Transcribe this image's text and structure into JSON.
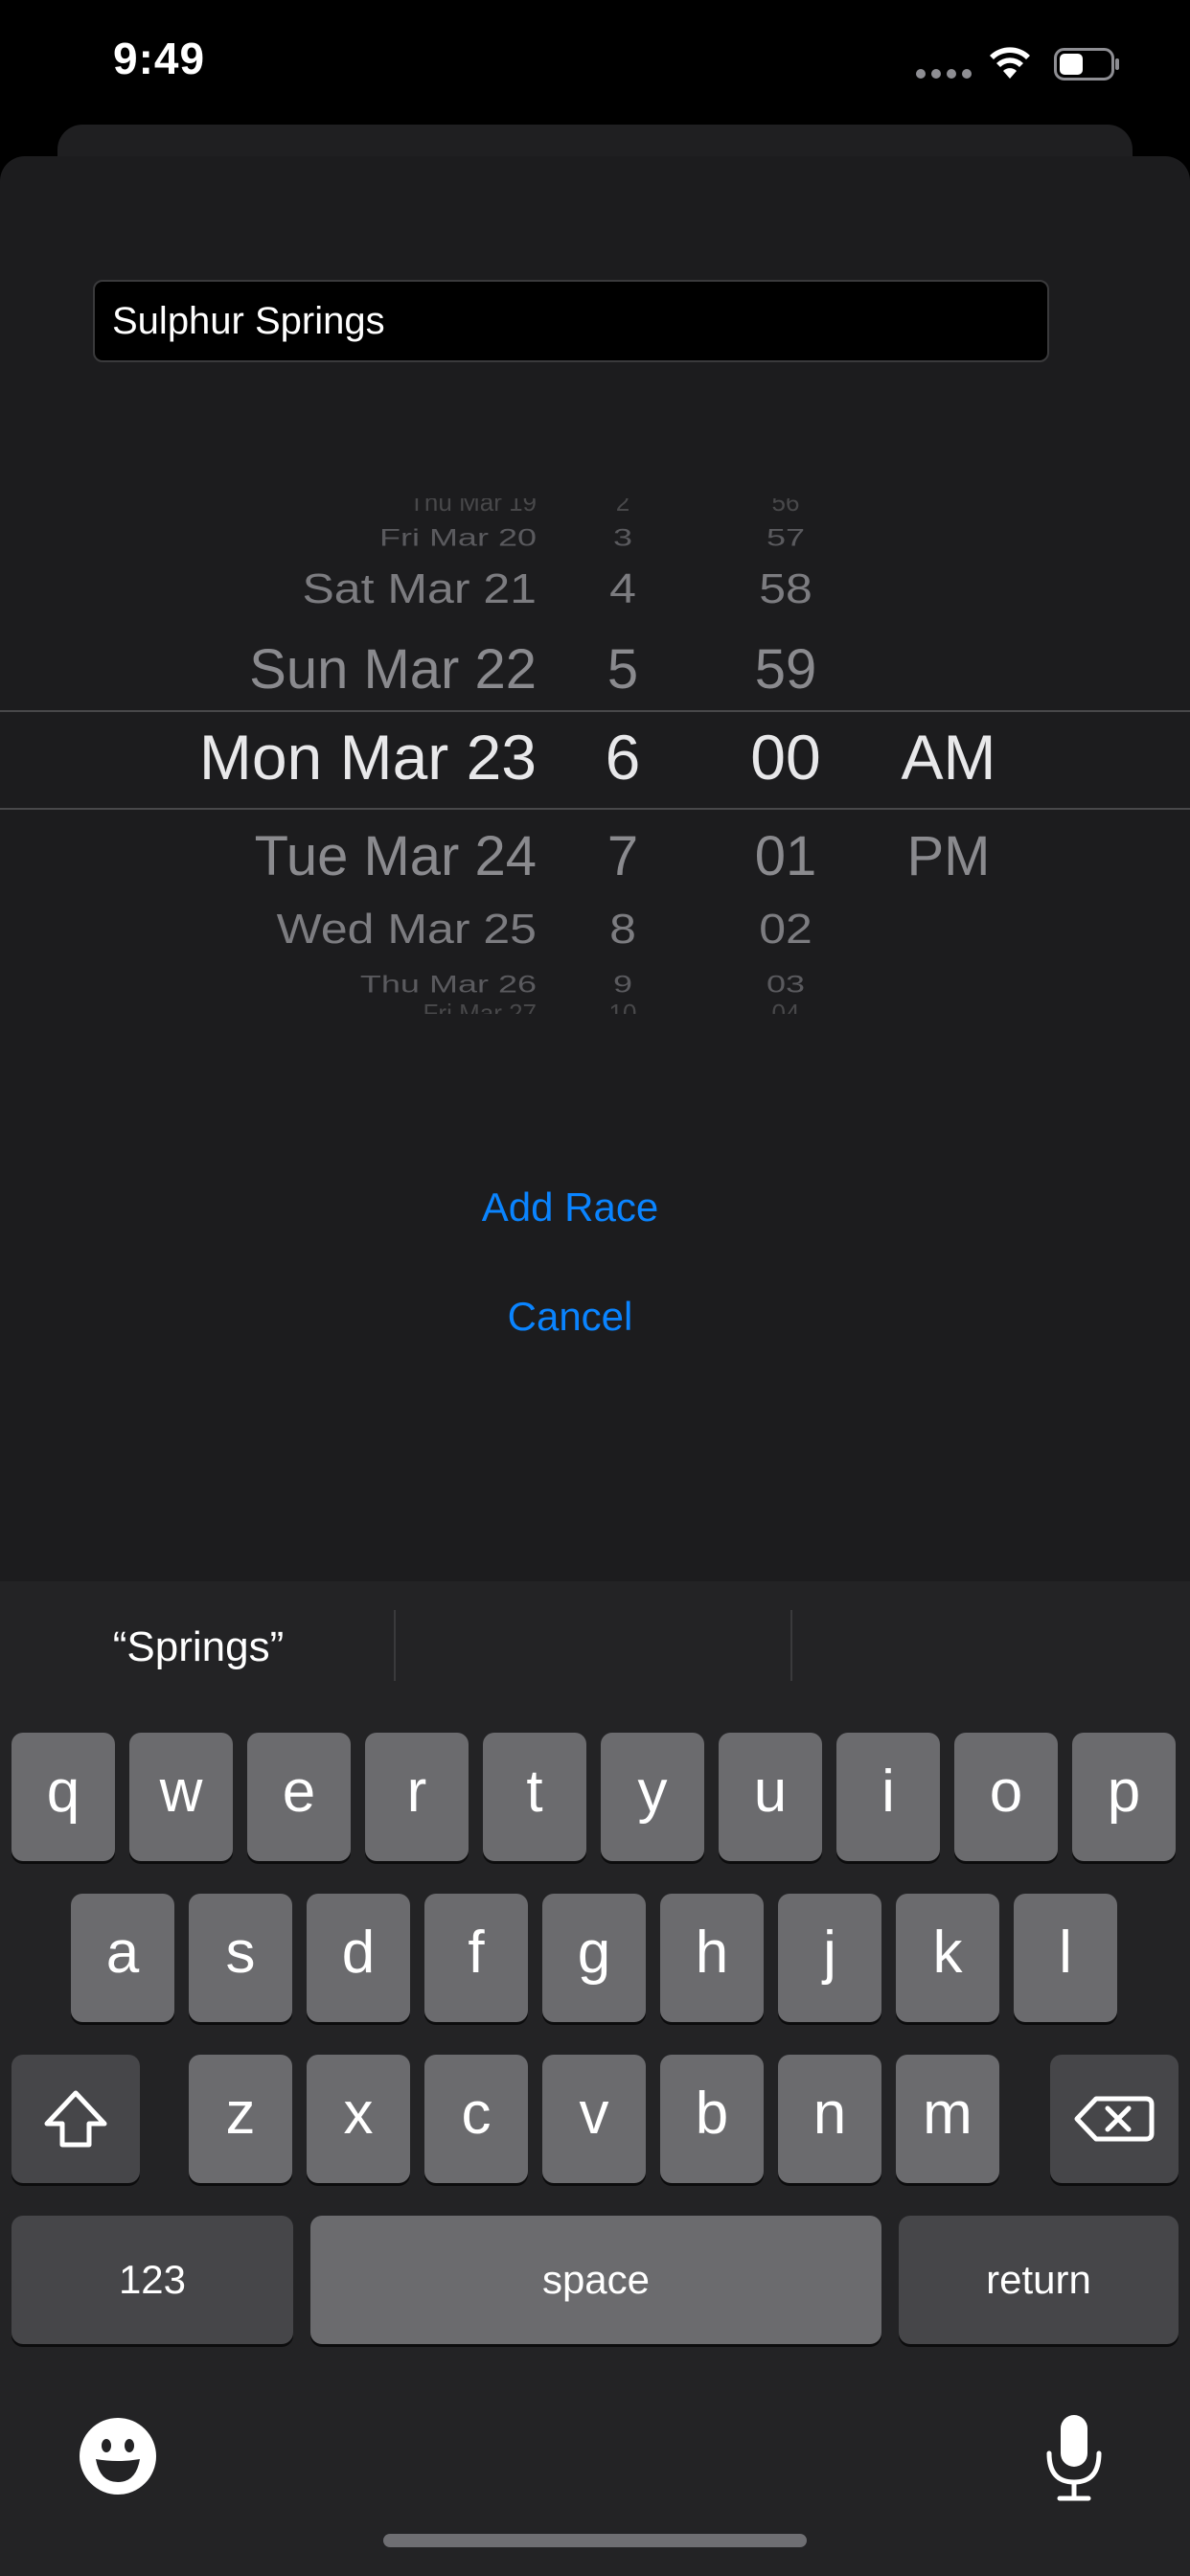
{
  "status_bar": {
    "time": "9:49"
  },
  "form": {
    "race_name_value": "Sulphur Springs"
  },
  "picker": {
    "dates": [
      "Thu Mar 19",
      "Fri Mar 20",
      "Sat Mar 21",
      "Sun Mar 22",
      "Mon Mar 23",
      "Tue Mar 24",
      "Wed Mar 25",
      "Thu Mar 26",
      "Fri Mar 27"
    ],
    "hours": [
      "2",
      "3",
      "4",
      "5",
      "6",
      "7",
      "8",
      "9",
      "10"
    ],
    "minutes": [
      "56",
      "57",
      "58",
      "59",
      "00",
      "01",
      "02",
      "03",
      "04"
    ],
    "ampm": [
      "",
      "",
      "",
      "",
      "AM",
      "PM",
      "",
      "",
      ""
    ],
    "selected": {
      "date": "Mon Mar 23",
      "hour": "6",
      "minute": "00",
      "ampm": "AM"
    }
  },
  "actions": {
    "add_race": "Add Race",
    "cancel": "Cancel"
  },
  "keyboard": {
    "suggestions": [
      "“Springs”",
      "",
      ""
    ],
    "row1": [
      "q",
      "w",
      "e",
      "r",
      "t",
      "y",
      "u",
      "i",
      "o",
      "p"
    ],
    "row2": [
      "a",
      "s",
      "d",
      "f",
      "g",
      "h",
      "j",
      "k",
      "l"
    ],
    "row3": [
      "z",
      "x",
      "c",
      "v",
      "b",
      "n",
      "m"
    ],
    "numbers_key": "123",
    "space_key": "space",
    "return_key": "return"
  },
  "colors": {
    "accent": "#0a84ff",
    "sheet": "#1c1c1e",
    "key": "#6b6b6e",
    "key_dark": "#464649"
  }
}
